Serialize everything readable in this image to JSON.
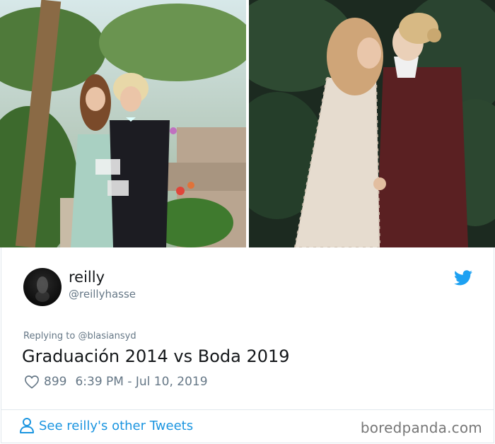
{
  "photos": {
    "left": {
      "label": "prom-photo"
    },
    "right": {
      "label": "wedding-photo"
    }
  },
  "tweet": {
    "display_name": "reilly",
    "handle": "@reillyhasse",
    "reply_prefix": "Replying to",
    "reply_to": "@blasiansyd",
    "text": "Graduación 2014 vs Boda 2019",
    "likes": "899",
    "timestamp": "6:39 PM - Jul 10, 2019",
    "see_more_label": "See reilly's other Tweets"
  },
  "footer": {
    "watermark": "boredpanda.com"
  },
  "colors": {
    "twitter_blue": "#1da1f2",
    "link_blue": "#1b95e0",
    "text_primary": "#14171a",
    "text_secondary": "#657786"
  },
  "icons": [
    "twitter-bird-icon",
    "heart-icon",
    "person-icon"
  ]
}
